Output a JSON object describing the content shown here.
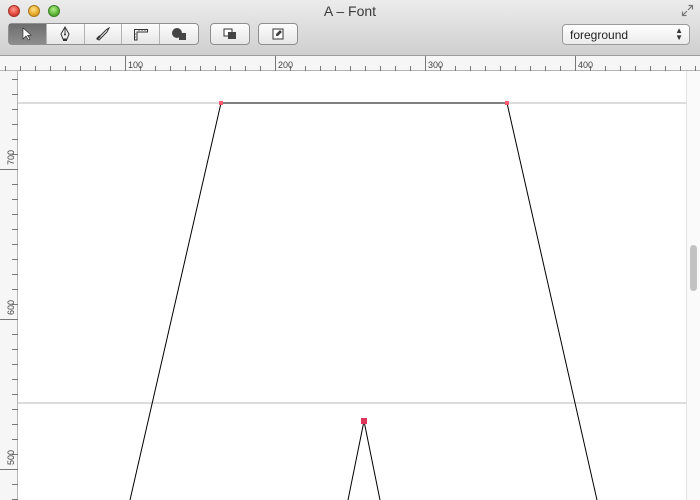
{
  "window": {
    "title": "A – Font"
  },
  "toolbar": {
    "tools": [
      {
        "name": "pointer",
        "active": true
      },
      {
        "name": "pen",
        "active": false
      },
      {
        "name": "knife",
        "active": false
      },
      {
        "name": "ruler",
        "active": false
      },
      {
        "name": "shapes",
        "active": false
      }
    ],
    "buttons": [
      {
        "name": "overlap-toggle"
      },
      {
        "name": "transform"
      }
    ],
    "layer_select": {
      "value": "foreground"
    }
  },
  "rulers": {
    "horizontal_labels": [
      "100",
      "200",
      "300",
      "400"
    ],
    "vertical_labels": [
      "700",
      "600",
      "500"
    ]
  },
  "colors": {
    "on_curve_point": "#ff5a6e",
    "selected_point": "#e0355b",
    "guide_line": "#b8b8b8",
    "outline": "#000000"
  }
}
